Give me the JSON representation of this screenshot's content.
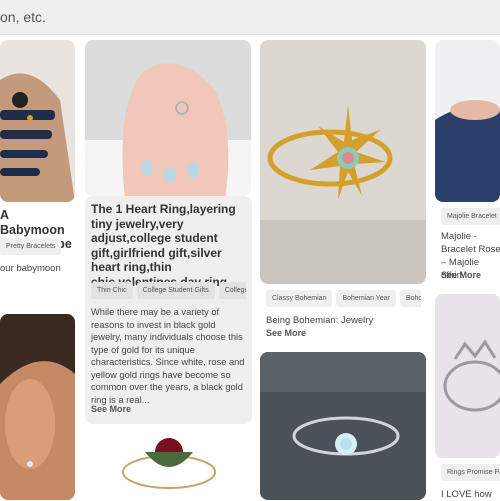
{
  "search": {
    "placeholder_tail": "on, etc."
  },
  "cards": {
    "c1": {
      "title_line1": "A Babymoon",
      "title_line2": "le Wardrobe",
      "tag": "Pretty Bracelets",
      "desc": "our babymoon"
    },
    "c2": {
      "title": "The 1 Heart Ring,layering tiny jewelry,very adjust,college student gift,girlfriend gift,silver heart ring,thin chic,valentines day ring",
      "tags": [
        "Thin Chic",
        "College Student Gifts",
        "College"
      ],
      "desc": "While there may be a variety of reasons to invest in black gold jewelry, many individuals choose this type of gold for its unique characteristics. Since white, rose and yellow gold rings have become so common over the years, a black gold ring is a real...",
      "see_more": "See More"
    },
    "c3": {
      "tags": [
        "Classy Bohemian",
        "Bohemian Year",
        "Boho"
      ],
      "desc": "Being Bohemian: Jewelry",
      "see_more": "See More"
    },
    "c4": {
      "tag": "Majolie Bracelet",
      "desc": "Majolie - Bracelet Rose – Majolie offrir!",
      "see_more": "See More"
    },
    "c5": {
      "tag": "Rings Promise Pa",
      "desc": "I LOVE how"
    }
  },
  "icons": {
    "chevron": "›"
  },
  "colors": {
    "gold": "#d4a02a",
    "sweater": "#2c3f6b",
    "tag_bg": "#efefef"
  }
}
